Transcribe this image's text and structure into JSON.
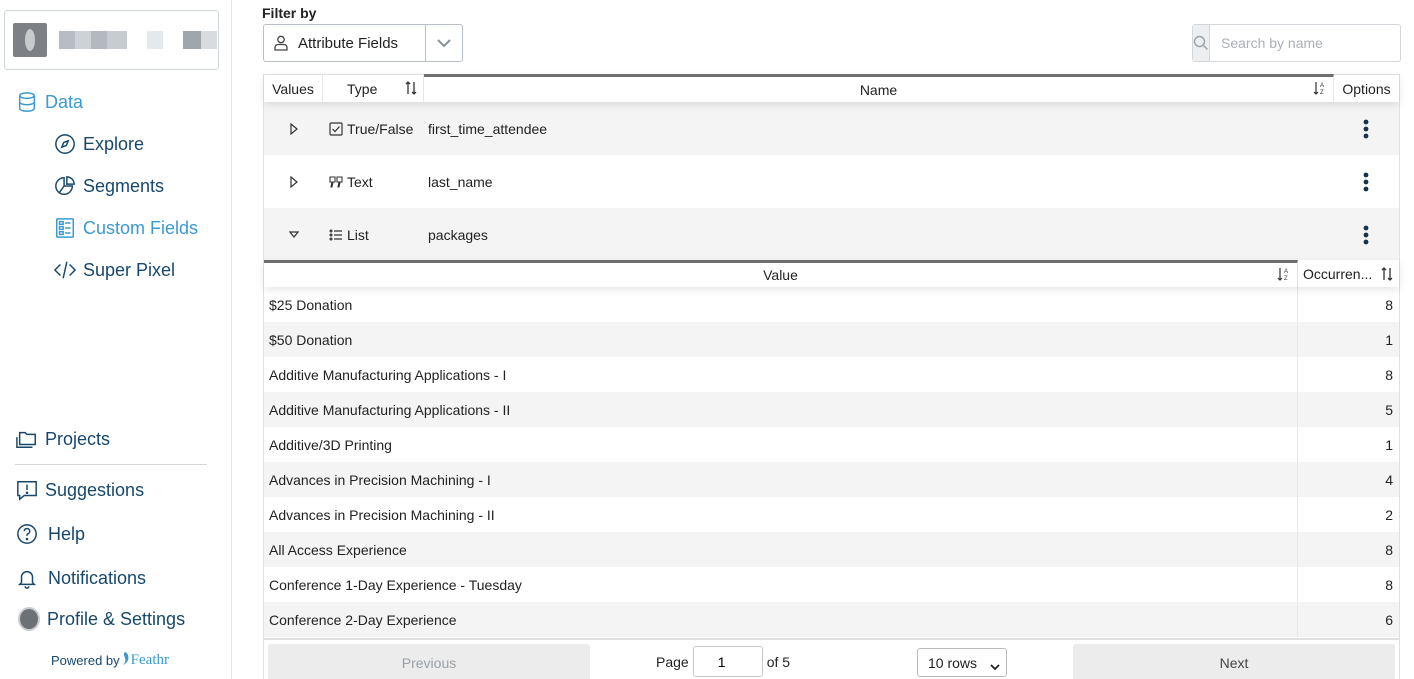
{
  "sidebar": {
    "nav": {
      "data": "Data",
      "explore": "Explore",
      "segments": "Segments",
      "custom_fields": "Custom Fields",
      "super_pixel": "Super Pixel",
      "projects": "Projects",
      "suggestions": "Suggestions",
      "help": "Help",
      "notifications": "Notifications",
      "profile": "Profile & Settings"
    },
    "powered_by": "Powered by",
    "brand": "Feathr"
  },
  "filter": {
    "label": "Filter by",
    "selected": "Attribute Fields"
  },
  "search": {
    "placeholder": "Search by name"
  },
  "table": {
    "headers": {
      "values": "Values",
      "type": "Type",
      "name": "Name",
      "options": "Options"
    },
    "rows": [
      {
        "type": "True/False",
        "type_icon": "checkbox-icon",
        "name": "first_time_attendee",
        "expanded": false
      },
      {
        "type": "Text",
        "type_icon": "quote-icon",
        "name": "last_name",
        "expanded": false
      },
      {
        "type": "List",
        "type_icon": "list-icon",
        "name": "packages",
        "expanded": true
      }
    ]
  },
  "values_table": {
    "headers": {
      "value": "Value",
      "occurrences": "Occurren..."
    },
    "rows": [
      {
        "value": "$25 Donation",
        "count": "8"
      },
      {
        "value": "$50 Donation",
        "count": "1"
      },
      {
        "value": "Additive Manufacturing Applications - I",
        "count": "8"
      },
      {
        "value": "Additive Manufacturing Applications - II",
        "count": "5"
      },
      {
        "value": "Additive/3D Printing",
        "count": "1"
      },
      {
        "value": "Advances in Precision Machining - I",
        "count": "4"
      },
      {
        "value": "Advances in Precision Machining - II",
        "count": "2"
      },
      {
        "value": "All Access Experience",
        "count": "8"
      },
      {
        "value": "Conference 1-Day Experience - Tuesday",
        "count": "8"
      },
      {
        "value": "Conference 2-Day Experience",
        "count": "6"
      }
    ]
  },
  "pagination": {
    "previous": "Previous",
    "next": "Next",
    "page_label": "Page",
    "page_value": "1",
    "of_label": "of 5",
    "rows_label": "10 rows"
  },
  "colors": {
    "nav": "#17486b",
    "active": "#3a9bd0"
  }
}
